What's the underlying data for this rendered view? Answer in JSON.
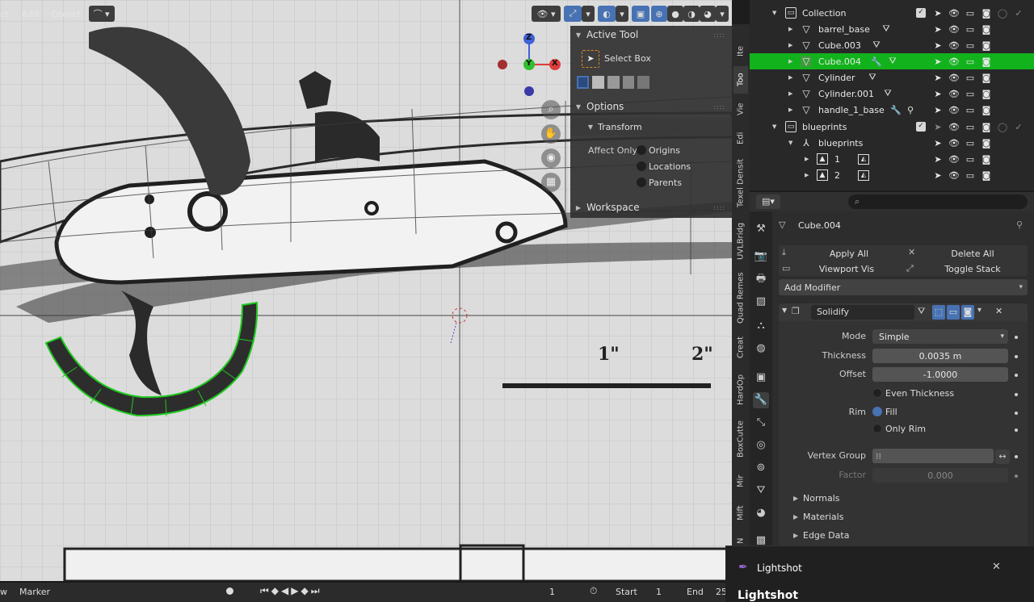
{
  "viewport_header": {
    "menus": [
      "ct",
      "Add",
      "Object"
    ]
  },
  "gizmo": {
    "z": "Z",
    "y": "Y",
    "x": "X"
  },
  "n_panel": {
    "active_tool_title": "Active Tool",
    "select_box": "Select Box",
    "options_title": "Options",
    "transform_title": "Transform",
    "affect_only_label": "Affect Only",
    "affect_options": [
      "Origins",
      "Locations",
      "Parents"
    ],
    "workspace_title": "Workspace",
    "grip": "::::"
  },
  "n_tabs": [
    "Ite",
    "Too",
    "Vie",
    "Edi",
    "Texel Densit",
    "UVLBridg",
    "Quad Remes",
    "Creat",
    "HardOp",
    "BoxCutte",
    "Mir",
    "Mift",
    "N"
  ],
  "outliner": {
    "rows": [
      {
        "label": "Collection",
        "icon": "collection-icon",
        "depth": 1,
        "expanded": true,
        "selected": false
      },
      {
        "label": "barrel_base",
        "icon": "mesh-icon",
        "depth": 2,
        "expanded": false,
        "selected": false
      },
      {
        "label": "Cube.003",
        "icon": "mesh-icon",
        "depth": 2,
        "expanded": false,
        "selected": false
      },
      {
        "label": "Cube.004",
        "icon": "mesh-icon",
        "depth": 2,
        "expanded": false,
        "selected": true
      },
      {
        "label": "Cylinder",
        "icon": "mesh-icon",
        "depth": 2,
        "expanded": false,
        "selected": false
      },
      {
        "label": "Cylinder.001",
        "icon": "mesh-icon",
        "depth": 2,
        "expanded": false,
        "selected": false
      },
      {
        "label": "handle_1_base",
        "icon": "mesh-icon",
        "depth": 2,
        "expanded": false,
        "selected": false
      },
      {
        "label": "blueprints",
        "icon": "collection-icon",
        "depth": 1,
        "expanded": true,
        "selected": false
      },
      {
        "label": "blueprints",
        "icon": "empty-icon",
        "depth": 2,
        "expanded": true,
        "selected": false
      },
      {
        "label": "1",
        "icon": "image-empty-icon",
        "depth": 3,
        "expanded": false,
        "selected": false
      },
      {
        "label": "2",
        "icon": "image-empty-icon",
        "depth": 3,
        "expanded": false,
        "selected": false
      }
    ]
  },
  "properties": {
    "object_name": "Cube.004",
    "apply_all": "Apply All",
    "delete_all": "Delete All",
    "viewport_vis": "Viewport Vis",
    "toggle_stack": "Toggle Stack",
    "add_modifier": "Add Modifier",
    "modifier_name": "Solidify",
    "mode_label": "Mode",
    "mode_value": "Simple",
    "thickness_label": "Thickness",
    "thickness_value": "0.0035 m",
    "offset_label": "Offset",
    "offset_value": "-1.0000",
    "even_thickness": "Even Thickness",
    "rim_label": "Rim",
    "fill": "Fill",
    "only_rim": "Only Rim",
    "vertex_group_label": "Vertex Group",
    "factor_label": "Factor",
    "factor_value": "0.000",
    "subpanels": [
      "Normals",
      "Materials",
      "Edge Data"
    ]
  },
  "timeline": {
    "left_label": "w",
    "marker": "Marker",
    "current_frame": "1",
    "start_label": "Start",
    "start_value": "1",
    "end_label": "End",
    "end_value": "25"
  },
  "lightshot": {
    "app_name": "Lightshot",
    "heading": "Lightshot"
  },
  "colors": {
    "selection_green": "#12b21c",
    "accent_blue": "#4772b3",
    "axis_x": "#e03c3c",
    "axis_y": "#2fbf2f",
    "axis_z": "#3f60d6"
  }
}
